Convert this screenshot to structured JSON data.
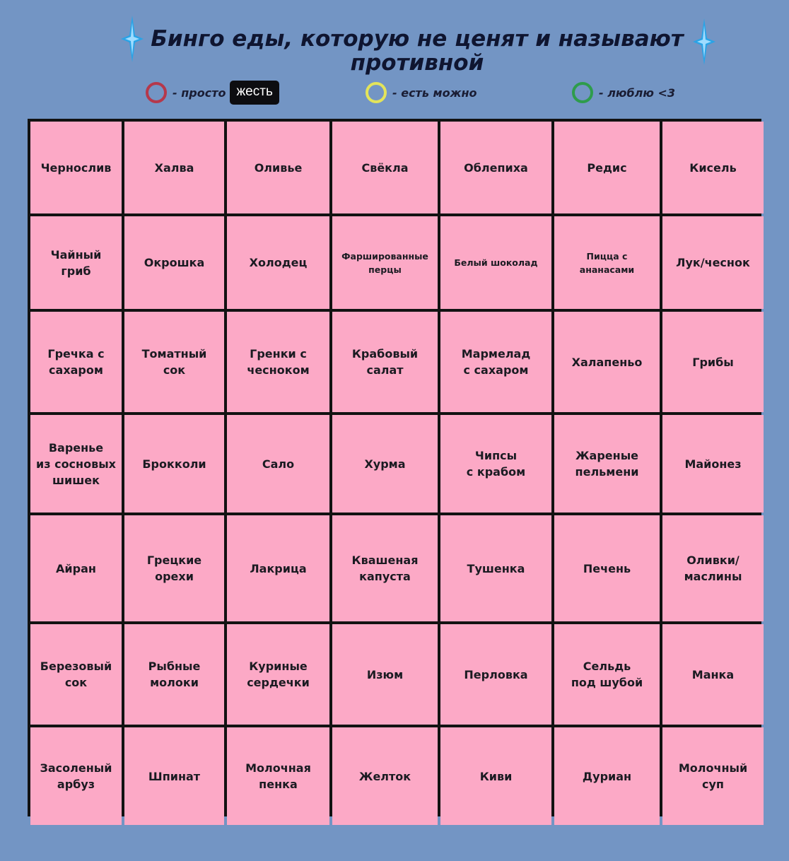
{
  "header": {
    "title_line1": "Бинго еды, которую не ценят и называют",
    "title_line2": "противной"
  },
  "legend": [
    {
      "color": "#b5384b",
      "label": "- просто",
      "badge": "жесть",
      "icon": "red-ring-icon"
    },
    {
      "color": "#e3e45a",
      "label": "- есть можно",
      "badge": "",
      "icon": "yellow-ring-icon"
    },
    {
      "color": "#2e9c4c",
      "label": "- люблю <3",
      "badge": "",
      "icon": "green-ring-icon"
    }
  ],
  "colors": {
    "background": "#7395c4",
    "cell": "#fca9c6",
    "grid_line": "#121212",
    "sparkle": "#2aa3e6"
  },
  "grid": {
    "rows": [
      [
        "Чернослив",
        "Халва",
        "Оливье",
        "Свёкла",
        "Облепиха",
        "Редис",
        "Кисель"
      ],
      [
        "Чайный\nгриб",
        "Окрошка",
        "Холодец",
        "Фаршированные\nперцы",
        "Белый шоколад",
        "Пицца с\nананасами",
        "Лук/чеснок"
      ],
      [
        "Гречка с\nсахаром",
        "Томатный\nсок",
        "Гренки с\nчесноком",
        "Крабовый\nсалат",
        "Мармелад\nс сахаром",
        "Халапеньо",
        "Грибы"
      ],
      [
        "Варенье\nиз сосновых\nшишек",
        "Брокколи",
        "Сало",
        "Хурма",
        "Чипсы\nс крабом",
        "Жареные\nпельмени",
        "Майонез"
      ],
      [
        "Айран",
        "Грецкие\nорехи",
        "Лакрица",
        "Квашеная\nкапуста",
        "Тушенка",
        "Печень",
        "Оливки/\nмаслины"
      ],
      [
        "Березовый\nсок",
        "Рыбные\nмолоки",
        "Куриные\nсердечки",
        "Изюм",
        "Перловка",
        "Сельдь\nпод шубой",
        "Манка"
      ],
      [
        "Засоленый\nарбуз",
        "Шпинат",
        "Молочная\nпенка",
        "Желток",
        "Киви",
        "Дуриан",
        "Молочный\nсуп"
      ]
    ]
  }
}
